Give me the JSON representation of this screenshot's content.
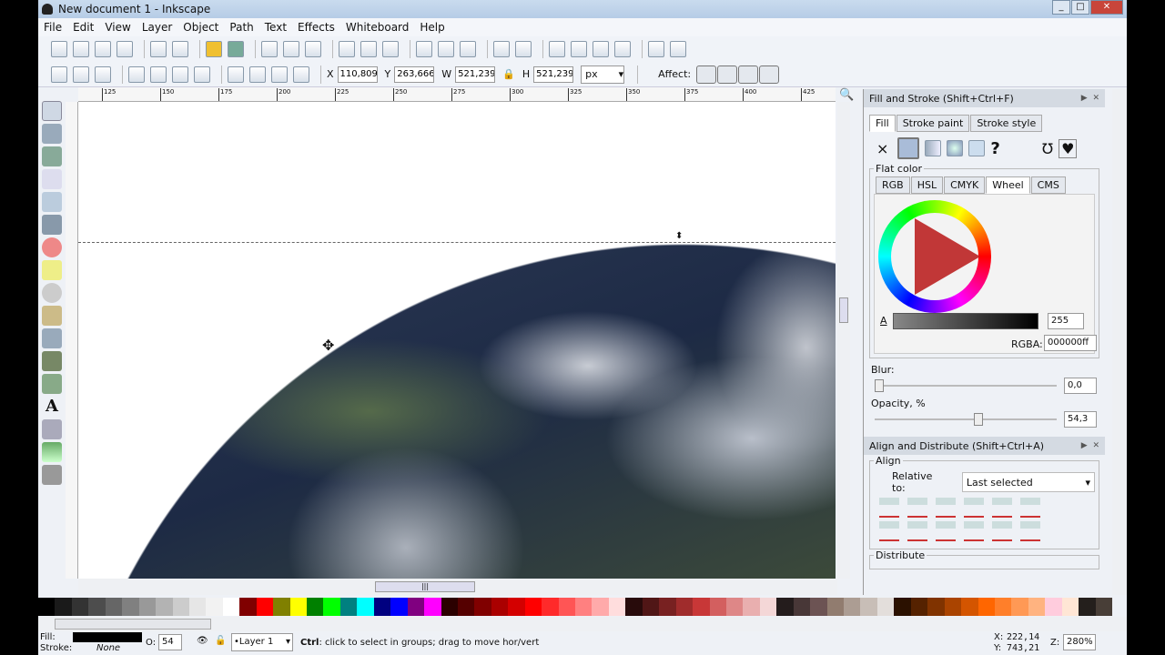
{
  "window": {
    "title": "New document 1 - Inkscape",
    "controls": [
      "_",
      "□",
      "✕"
    ]
  },
  "menu": [
    "File",
    "Edit",
    "View",
    "Layer",
    "Object",
    "Path",
    "Text",
    "Effects",
    "Whiteboard",
    "Help"
  ],
  "selectbar": {
    "x_label": "X",
    "x": "110,809",
    "y_label": "Y",
    "y": "263,666",
    "w_label": "W",
    "w": "521,239",
    "h_label": "H",
    "h": "521,239",
    "unit": "px",
    "affect_label": "Affect:"
  },
  "ruler": {
    "ticks": [
      "125",
      "150",
      "175",
      "200",
      "225",
      "250",
      "275",
      "300",
      "325",
      "350",
      "375",
      "400",
      "425"
    ]
  },
  "fill_stroke": {
    "title": "Fill and Stroke (Shift+Ctrl+F)",
    "tabs": [
      "Fill",
      "Stroke paint",
      "Stroke style"
    ],
    "unset": "×",
    "unknown": "?",
    "flat_color_label": "Flat color",
    "color_tabs": [
      "RGB",
      "HSL",
      "CMYK",
      "Wheel",
      "CMS"
    ],
    "alpha_label": "A",
    "alpha_value": "255",
    "rgba_label": "RGBA:",
    "rgba_value": "000000ff",
    "blur_label": "Blur:",
    "blur_value": "0,0",
    "blur_level": 0,
    "opacity_label": "Opacity, %",
    "opacity_value": "54,3",
    "opacity_level": 54.3
  },
  "align": {
    "title": "Align and Distribute (Shift+Ctrl+A)",
    "align_label": "Align",
    "relative_label": "Relative to:",
    "relative_value": "Last selected",
    "distribute_label": "Distribute"
  },
  "palette": [
    "#000",
    "#1a1a1a",
    "#333",
    "#4d4d4d",
    "#666",
    "#808080",
    "#999",
    "#b3b3b3",
    "#ccc",
    "#e6e6e6",
    "#f2f2f2",
    "#fff",
    "#800000",
    "#f00",
    "#808000",
    "#ff0",
    "#008000",
    "#0f0",
    "#008080",
    "#0ff",
    "#000080",
    "#00f",
    "#800080",
    "#f0f",
    "#2b0000",
    "#550000",
    "#800000",
    "#aa0000",
    "#d40000",
    "#f00",
    "#ff2a2a",
    "#f55",
    "#ff8080",
    "#faa",
    "#fdd",
    "#280b0b",
    "#501616",
    "#782121",
    "#a02c2c",
    "#c83737",
    "#d35f5f",
    "#de8787",
    "#e9afaf",
    "#f4d7d7",
    "#241c1c",
    "#483737",
    "#6c5353",
    "#917c6f",
    "#ac9d93",
    "#c8beb7",
    "#e3dedb",
    "#2b1100",
    "#552200",
    "#803300",
    "#aa4400",
    "#d45500",
    "#f60",
    "#ff7f2a",
    "#f95",
    "#ffb380",
    "#fcd",
    "#ffe6d5",
    "#241f1c",
    "#483e37"
  ],
  "status": {
    "fill_label": "Fill:",
    "stroke_label": "Stroke:",
    "stroke_value": "None",
    "fill_color": "#000000",
    "opacity_label": "O:",
    "opacity_value": "54",
    "layer": "•Layer 1",
    "message_key": "Ctrl",
    "message": ": click to select in groups; drag to move hor/vert",
    "cursor_x_label": "X:",
    "cursor_x": "222,14",
    "cursor_y_label": "Y:",
    "cursor_y": "743,21",
    "zoom_label": "Z:",
    "zoom": "280%"
  }
}
